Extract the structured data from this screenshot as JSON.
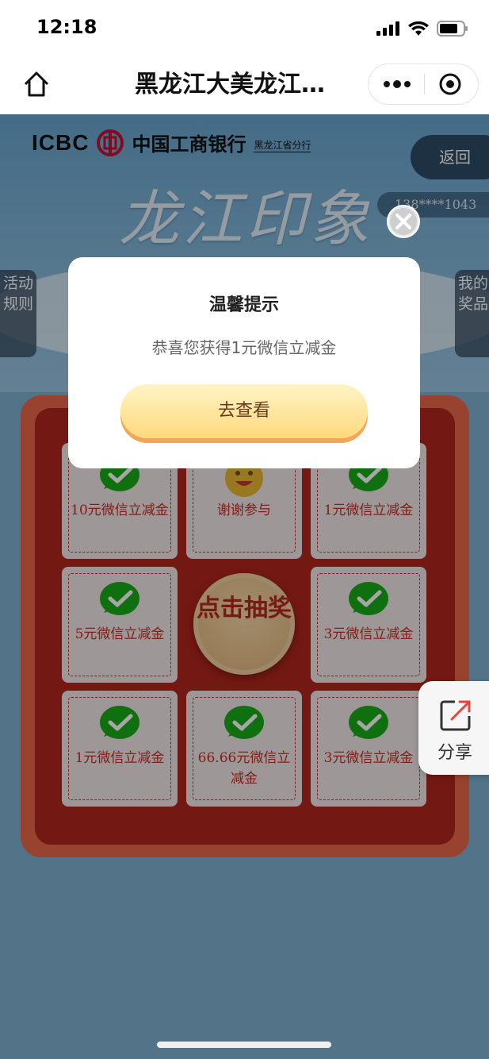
{
  "status_bar": {
    "time": "12:18"
  },
  "nav": {
    "title": "黑龙江大美龙江…"
  },
  "header": {
    "logo_text": "ICBC",
    "bank_name": "中国工商银行",
    "branch": "黑龙江省分行",
    "hero_title": "龙江印象",
    "back_label": "返回",
    "phone": "138****1043"
  },
  "side_tabs": {
    "rules": "活动规则",
    "prizes": "我的奖品"
  },
  "grid": {
    "cells": [
      {
        "label": "10元微信立减金",
        "icon": "wechat-icon"
      },
      {
        "label": "谢谢参与",
        "icon": "smiley-icon"
      },
      {
        "label": "1元微信立减金",
        "icon": "wechat-icon"
      },
      {
        "label": "5元微信立减金",
        "icon": "wechat-icon"
      },
      {
        "label": "3元微信立减金",
        "icon": "wechat-icon"
      },
      {
        "label": "1元微信立减金",
        "icon": "wechat-icon"
      },
      {
        "label": "66.66元微信立减金",
        "icon": "wechat-icon"
      },
      {
        "label": "3元微信立减金",
        "icon": "wechat-icon"
      }
    ],
    "draw_button": "点击抽奖"
  },
  "share": {
    "label": "分享"
  },
  "modal": {
    "title": "温馨提示",
    "message": "恭喜您获得1元微信立减金",
    "button": "去查看"
  },
  "colors": {
    "board_outer": "#e8684b",
    "board_inner": "#b1261d",
    "prize_text": "#cc2b22",
    "wechat_green": "#1aad19",
    "modal_button": "#fed97b"
  }
}
